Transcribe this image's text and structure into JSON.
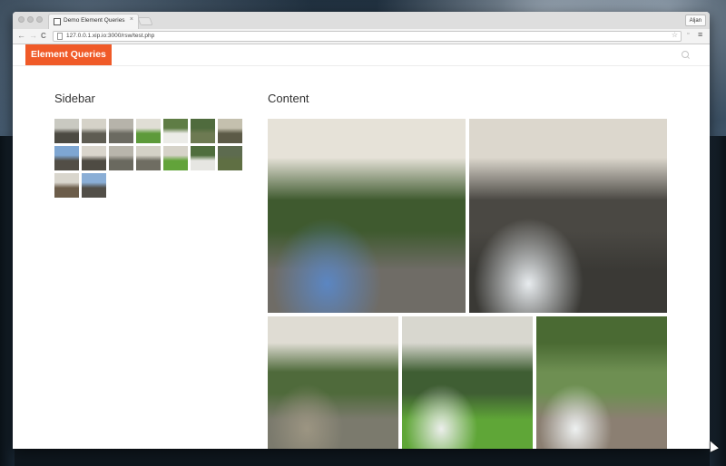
{
  "browser": {
    "tab_title": "Demo Element Queries",
    "tab_close": "×",
    "user_button": "Aljan",
    "url": "127.0.0.1.xip.io:3000/rsw/test.php",
    "nav": {
      "back": "←",
      "forward": "→",
      "reload": "C"
    },
    "star": "☆",
    "menu": "≡",
    "extension": "▫"
  },
  "site": {
    "brand": "Element Queries",
    "sidebar_title": "Sidebar",
    "content_title": "Content"
  },
  "thumbnails": [
    {
      "sky": "#c9c9c1",
      "land": "#4c4a42"
    },
    {
      "sky": "#d5d2c8",
      "land": "#5e5c52"
    },
    {
      "sky": "#b6b3aa",
      "land": "#6b6a61"
    },
    {
      "sky": "#e0ded5",
      "land": "#5d9a3a"
    },
    {
      "sky": "#5f7d45",
      "land": "#ecece8"
    },
    {
      "sky": "#4f6b3d",
      "land": "#6d7a52"
    },
    {
      "sky": "#c4c0ae",
      "land": "#5c5a47"
    },
    {
      "sky": "#7ea6d2",
      "land": "#524e46"
    },
    {
      "sky": "#d9d5cc",
      "land": "#4e4b43"
    },
    {
      "sky": "#b8b5ab",
      "land": "#6a695f"
    },
    {
      "sky": "#d4d1c6",
      "land": "#6f6d62"
    },
    {
      "sky": "#d6d3c9",
      "land": "#62a33a"
    },
    {
      "sky": "#4f6e3d",
      "land": "#e6e6e2"
    },
    {
      "sky": "#5d6b4f",
      "land": "#5f6f43"
    },
    {
      "sky": "#d9d6cd",
      "land": "#6c5d4a"
    },
    {
      "sky": "#8aaed6",
      "land": "#524f48"
    }
  ],
  "photos": [
    {
      "sky": "#e6e2d8",
      "mid": "#3f5a2f",
      "ground": "#6f6c66",
      "accent": "#5b86c2"
    },
    {
      "sky": "#dcd7cd",
      "mid": "#4a4843",
      "ground": "#3a3935",
      "accent": "#e8ecef"
    },
    {
      "sky": "#dfdcd3",
      "mid": "#4f6a3b",
      "ground": "#7b7a6d",
      "accent": "#9c9582"
    },
    {
      "sky": "#d8d7cf",
      "mid": "#3f5e33",
      "ground": "#5fa637",
      "accent": "#eceeec"
    },
    {
      "sky": "#4a6a33",
      "mid": "#6e8f52",
      "ground": "#8b7f72",
      "accent": "#eef1f1"
    }
  ]
}
